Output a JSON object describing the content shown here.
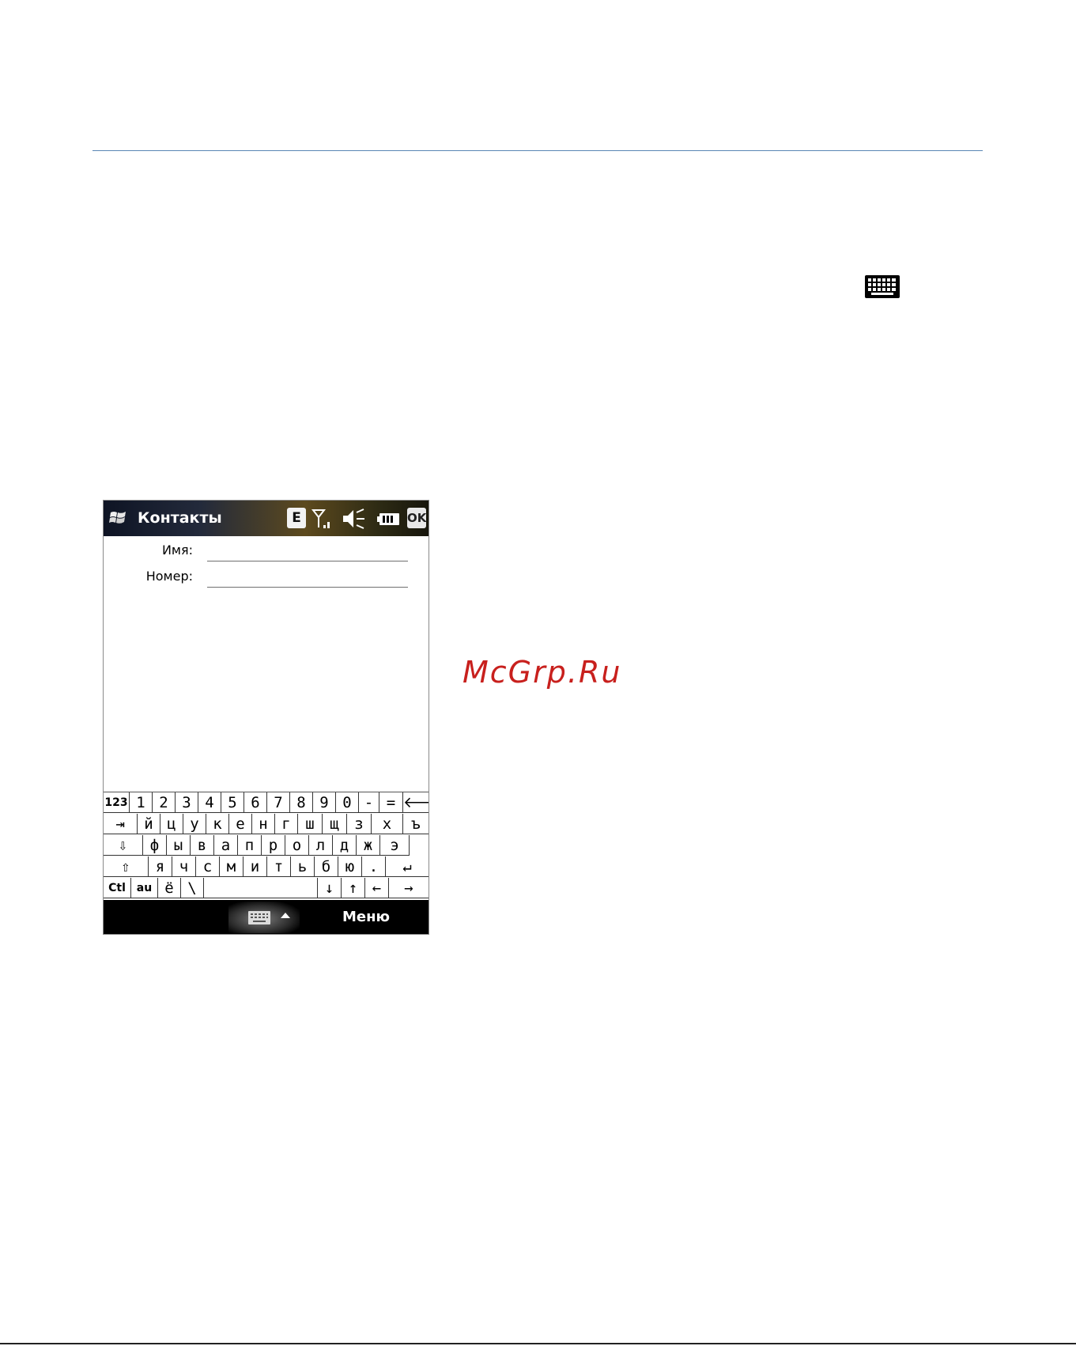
{
  "watermark": "McGrp.Ru",
  "phone": {
    "title": "Контакты",
    "status": {
      "network_label": "E",
      "ok_label": "OK"
    },
    "form": {
      "name_label": "Имя:",
      "number_label": "Номер:",
      "name_value": "",
      "number_value": ""
    },
    "keyboard": {
      "rows": [
        [
          "123",
          "1",
          "2",
          "3",
          "4",
          "5",
          "6",
          "7",
          "8",
          "9",
          "0",
          "-",
          "=",
          "🡐"
        ],
        [
          "⇥",
          "й",
          "ц",
          "у",
          "к",
          "е",
          "н",
          "г",
          "ш",
          "щ",
          "з",
          "х",
          "ъ"
        ],
        [
          "⇩",
          "ф",
          "ы",
          "в",
          "а",
          "п",
          "р",
          "о",
          "л",
          "д",
          "ж",
          "э"
        ],
        [
          "⇧",
          "я",
          "ч",
          "с",
          "м",
          "и",
          "т",
          "ь",
          "б",
          "ю",
          ".",
          "↵"
        ],
        [
          "Ctl",
          "au",
          "ё",
          "\\",
          " ",
          "↓",
          "↑",
          "←",
          "→"
        ]
      ]
    },
    "menubar": {
      "menu_label": "Меню"
    }
  },
  "icons": {
    "windows_logo": "windows-logo-icon",
    "signal": "signal-icon",
    "speaker": "speaker-muted-icon",
    "battery": "battery-icon",
    "keyboard": "keyboard-icon"
  }
}
